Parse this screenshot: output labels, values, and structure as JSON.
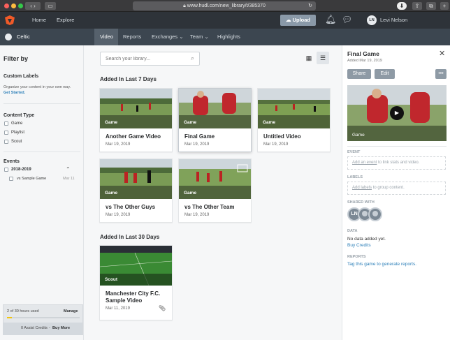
{
  "browser": {
    "url": "www.hudl.com/new_library/t/385370"
  },
  "topnav": {
    "home": "Home",
    "explore": "Explore",
    "upload": "Upload",
    "user_initials": "LN",
    "user_name": "Levi Nelson"
  },
  "subnav": {
    "team": "Celtic",
    "tabs": [
      "Video",
      "Reports",
      "Exchanges",
      "Team",
      "Highlights"
    ],
    "active_tab": "Video"
  },
  "sidebar": {
    "title": "Filter by",
    "custom_labels": {
      "title": "Custom Labels",
      "desc": "Organize your content in your own way.",
      "link": "Get Started."
    },
    "content_type": {
      "title": "Content Type",
      "options": [
        "Game",
        "Playlist",
        "Scout"
      ]
    },
    "events": {
      "title": "Events",
      "season": "2018-2019",
      "items": [
        {
          "label": "vs Sample Game",
          "date": "Mar 11"
        }
      ]
    },
    "storage": {
      "usage": "2 of 30 hours used",
      "manage": "Manage",
      "credits": "0 Assist Credits",
      "buy": "Buy More",
      "usage_fraction": 0.07
    }
  },
  "main": {
    "search_placeholder": "Search your library...",
    "section1": "Added In Last 7 Days",
    "section2": "Added In Last 30 Days",
    "cards": [
      {
        "tag": "Game",
        "title": "Another Game Video",
        "date": "Mar 19, 2019"
      },
      {
        "tag": "Game",
        "title": "Final Game",
        "date": "Mar 19, 2019"
      },
      {
        "tag": "Game",
        "title": "Untitled Video",
        "date": "Mar 19, 2019"
      },
      {
        "tag": "Game",
        "title": "vs The Other Guys",
        "date": "Mar 19, 2019"
      },
      {
        "tag": "Game",
        "title": "vs The Other Team",
        "date": "Mar 19, 2019"
      },
      {
        "tag": "Scout",
        "title": "Manchester City F.C. Sample Video",
        "date": "Mar 11, 2019"
      }
    ]
  },
  "panel": {
    "title": "Final Game",
    "added": "Added Mar 19, 2019",
    "share": "Share",
    "edit": "Edit",
    "more": "•••",
    "video_tag": "Game",
    "event_label": "EVENT",
    "event_link": "Add an event",
    "event_rest": " to link stats and video.",
    "labels_label": "LABELS",
    "labels_link": "Add labels",
    "labels_rest": " to group content.",
    "shared_label": "SHARED WITH",
    "shared_initials": "LN",
    "data_label": "DATA",
    "data_text": "No data added yet.",
    "data_link": "Buy Credits",
    "reports_label": "REPORTS",
    "reports_link": "Tag this game to generate reports."
  },
  "colors": {
    "nav": "#2e3339",
    "subnav": "#3c4650",
    "accent_link": "#2c7fb8",
    "upload": "#8a99a8",
    "hudl_orange": "#f05a28"
  }
}
